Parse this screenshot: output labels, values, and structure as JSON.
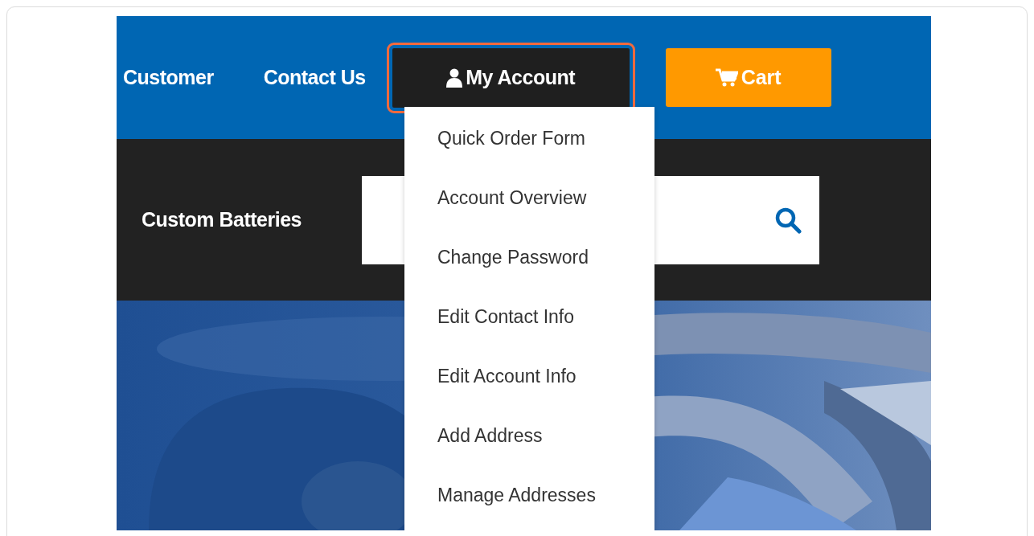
{
  "header": {
    "nav_links": [
      {
        "label": "Customer"
      },
      {
        "label": "Contact Us"
      }
    ],
    "account_button": {
      "label": "My Account",
      "highlighted": true
    },
    "cart_button": {
      "label": "Cart"
    }
  },
  "search_bar": {
    "category": "Custom Batteries"
  },
  "account_menu": {
    "expanded": true,
    "items": [
      {
        "label": "Quick Order Form"
      },
      {
        "label": "Account Overview"
      },
      {
        "label": "Change Password"
      },
      {
        "label": "Edit Contact Info"
      },
      {
        "label": "Edit Account Info"
      },
      {
        "label": "Add Address"
      },
      {
        "label": "Manage Addresses"
      }
    ]
  }
}
